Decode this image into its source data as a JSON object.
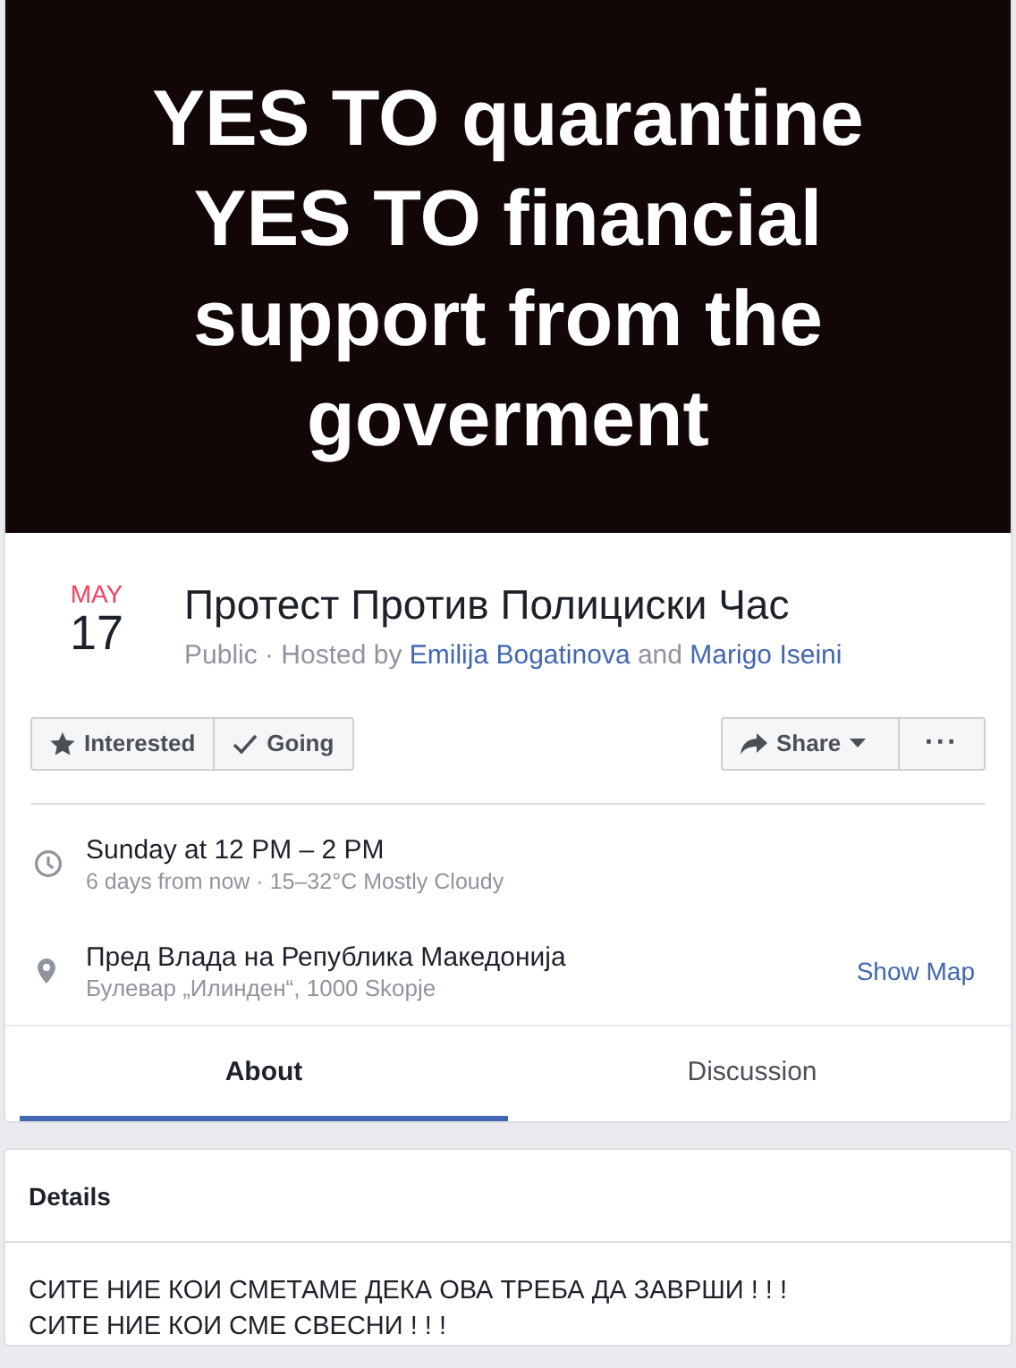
{
  "cover": {
    "lines": [
      "YES TO quarantine",
      "YES TO financial",
      "support from the",
      "goverment"
    ]
  },
  "event": {
    "month": "MAY",
    "day": "17",
    "title": "Протест Против Полициски Час",
    "privacy": "Public",
    "separator": "·",
    "hosted_by": "Hosted by",
    "hosts": [
      "Emilija Bogatinova",
      "Marigo Iseini"
    ],
    "and": "and"
  },
  "actions": [
    {
      "kind": "star",
      "label": "Interested"
    },
    {
      "kind": "check",
      "label": "Going"
    }
  ],
  "share": {
    "label": "Share"
  },
  "more": {
    "label": "···"
  },
  "when": {
    "main": "Sunday at 12 PM – 2 PM",
    "sub": "6 days from now · 15–32°C Mostly Cloudy"
  },
  "where": {
    "main": "Пред Влада на Република Македонија",
    "sub": "Булевар „Илинден“, 1000 Skopje",
    "link": "Show Map"
  },
  "tabs": [
    {
      "label": "About",
      "selected": true
    },
    {
      "label": "Discussion",
      "selected": false
    }
  ],
  "details": {
    "title": "Details",
    "lines": [
      "СИТЕ НИЕ КОИ СМЕТАМЕ ДЕКА ОВА ТРЕБА ДА ЗАВРШИ ! ! !",
      "СИТЕ НИЕ КОИ СМЕ СВЕСНИ ! ! !"
    ]
  }
}
